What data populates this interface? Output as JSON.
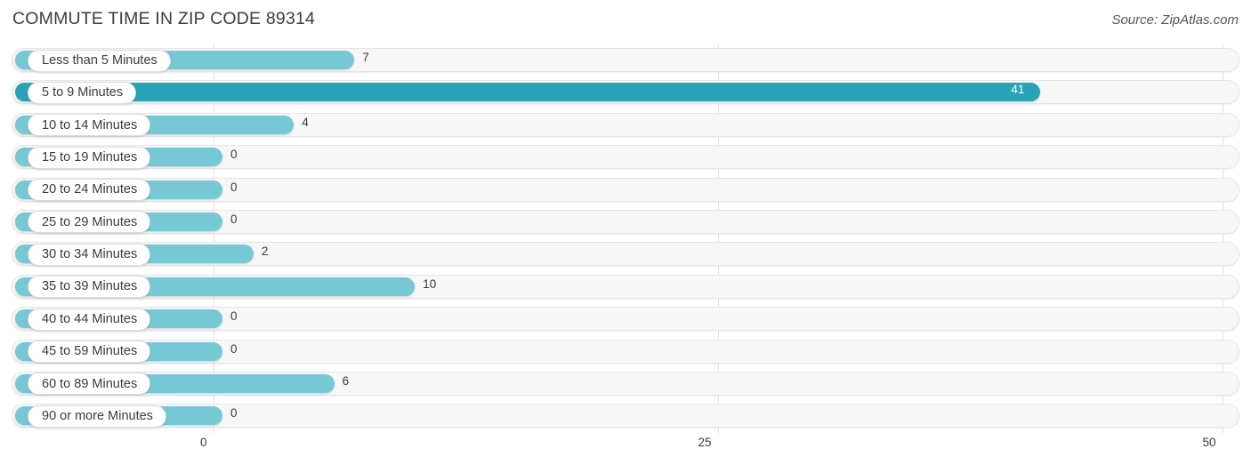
{
  "header": {
    "title": "COMMUTE TIME IN ZIP CODE 89314",
    "source": "Source: ZipAtlas.com"
  },
  "colors": {
    "bar": "#76c8d4",
    "bar_highlight": "#27a2b6",
    "track": "#f7f7f7",
    "gridline": "#e2e2e4",
    "text": "#3a3a40"
  },
  "chart_data": {
    "type": "bar",
    "orientation": "horizontal",
    "title": "COMMUTE TIME IN ZIP CODE 89314",
    "xlabel": "",
    "ylabel": "",
    "xlim": [
      0,
      50
    ],
    "grid": true,
    "legend": false,
    "ticks": [
      "0",
      "25",
      "50"
    ],
    "tick_values": [
      0,
      25,
      50
    ],
    "categories": [
      "Less than 5 Minutes",
      "5 to 9 Minutes",
      "10 to 14 Minutes",
      "15 to 19 Minutes",
      "20 to 24 Minutes",
      "25 to 29 Minutes",
      "30 to 34 Minutes",
      "35 to 39 Minutes",
      "40 to 44 Minutes",
      "45 to 59 Minutes",
      "60 to 89 Minutes",
      "90 or more Minutes"
    ],
    "values": [
      7,
      41,
      4,
      0,
      0,
      0,
      2,
      10,
      0,
      0,
      6,
      0
    ],
    "value_labels": [
      "7",
      "41",
      "4",
      "0",
      "0",
      "0",
      "2",
      "10",
      "0",
      "0",
      "6",
      "0"
    ],
    "highlight_index": 1
  }
}
